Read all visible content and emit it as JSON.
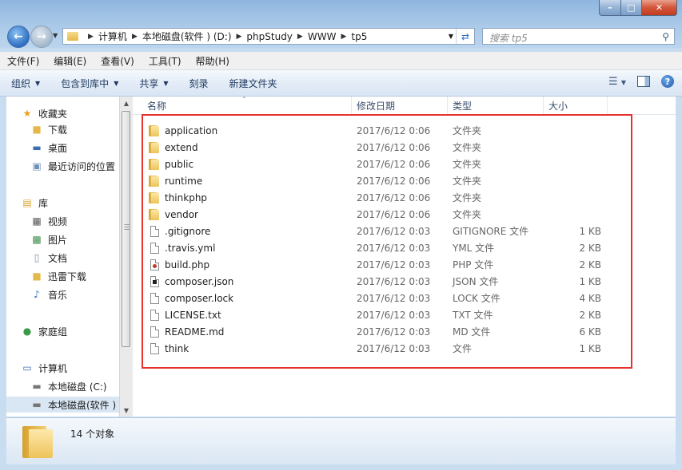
{
  "window": {
    "colors": {
      "close": "#c13b1f",
      "highlight_border": "#e5322f",
      "selection": "#d9e6f4"
    }
  },
  "address": {
    "crumbs": [
      "计算机",
      "本地磁盘(软件 ) (D:)",
      "phpStudy",
      "WWW",
      "tp5"
    ]
  },
  "search": {
    "placeholder": "搜索 tp5"
  },
  "menu": [
    "文件(F)",
    "编辑(E)",
    "查看(V)",
    "工具(T)",
    "帮助(H)"
  ],
  "toolbar": [
    {
      "label": "组织",
      "dropdown": true
    },
    {
      "label": "包含到库中",
      "dropdown": true
    },
    {
      "label": "共享",
      "dropdown": true
    },
    {
      "label": "刻录",
      "dropdown": false
    },
    {
      "label": "新建文件夹",
      "dropdown": false
    }
  ],
  "nav": [
    {
      "label": "收藏夹",
      "icon": "star-icon",
      "indent": 0,
      "selected": false
    },
    {
      "label": "下载",
      "icon": "download-folder-icon",
      "indent": 1,
      "selected": false
    },
    {
      "label": "桌面",
      "icon": "desktop-icon",
      "indent": 1,
      "selected": false
    },
    {
      "label": "最近访问的位置",
      "icon": "recent-places-icon",
      "indent": 1,
      "selected": false
    },
    {
      "label": "库",
      "icon": "library-icon",
      "indent": 0,
      "selected": false
    },
    {
      "label": "视频",
      "icon": "video-icon",
      "indent": 1,
      "selected": false
    },
    {
      "label": "图片",
      "icon": "picture-icon",
      "indent": 1,
      "selected": false
    },
    {
      "label": "文档",
      "icon": "document-icon",
      "indent": 1,
      "selected": false
    },
    {
      "label": "迅雷下载",
      "icon": "thunder-download-icon",
      "indent": 1,
      "selected": false
    },
    {
      "label": "音乐",
      "icon": "music-icon",
      "indent": 1,
      "selected": false
    },
    {
      "label": "家庭组",
      "icon": "homegroup-icon",
      "indent": 0,
      "selected": false
    },
    {
      "label": "计算机",
      "icon": "computer-icon",
      "indent": 0,
      "selected": false
    },
    {
      "label": "本地磁盘 (C:)",
      "icon": "drive-icon",
      "indent": 1,
      "selected": false
    },
    {
      "label": "本地磁盘(软件 )",
      "icon": "drive-icon",
      "indent": 1,
      "selected": true
    }
  ],
  "columns": {
    "name": "名称",
    "date": "修改日期",
    "type": "类型",
    "size": "大小"
  },
  "files": [
    {
      "name": "application",
      "date": "2017/6/12 0:06",
      "type": "文件夹",
      "size": "",
      "icon": "folder"
    },
    {
      "name": "extend",
      "date": "2017/6/12 0:06",
      "type": "文件夹",
      "size": "",
      "icon": "folder"
    },
    {
      "name": "public",
      "date": "2017/6/12 0:06",
      "type": "文件夹",
      "size": "",
      "icon": "folder"
    },
    {
      "name": "runtime",
      "date": "2017/6/12 0:06",
      "type": "文件夹",
      "size": "",
      "icon": "folder"
    },
    {
      "name": "thinkphp",
      "date": "2017/6/12 0:06",
      "type": "文件夹",
      "size": "",
      "icon": "folder"
    },
    {
      "name": "vendor",
      "date": "2017/6/12 0:06",
      "type": "文件夹",
      "size": "",
      "icon": "folder"
    },
    {
      "name": ".gitignore",
      "date": "2017/6/12 0:03",
      "type": "GITIGNORE 文件",
      "size": "1 KB",
      "icon": "file"
    },
    {
      "name": ".travis.yml",
      "date": "2017/6/12 0:03",
      "type": "YML 文件",
      "size": "2 KB",
      "icon": "file"
    },
    {
      "name": "build.php",
      "date": "2017/6/12 0:03",
      "type": "PHP 文件",
      "size": "2 KB",
      "icon": "php"
    },
    {
      "name": "composer.json",
      "date": "2017/6/12 0:03",
      "type": "JSON 文件",
      "size": "1 KB",
      "icon": "json"
    },
    {
      "name": "composer.lock",
      "date": "2017/6/12 0:03",
      "type": "LOCK 文件",
      "size": "4 KB",
      "icon": "file"
    },
    {
      "name": "LICENSE.txt",
      "date": "2017/6/12 0:03",
      "type": "TXT 文件",
      "size": "2 KB",
      "icon": "file"
    },
    {
      "name": "README.md",
      "date": "2017/6/12 0:03",
      "type": "MD 文件",
      "size": "6 KB",
      "icon": "file"
    },
    {
      "name": "think",
      "date": "2017/6/12 0:03",
      "type": "文件",
      "size": "1 KB",
      "icon": "file"
    }
  ],
  "status": {
    "count": "14 个对象"
  }
}
